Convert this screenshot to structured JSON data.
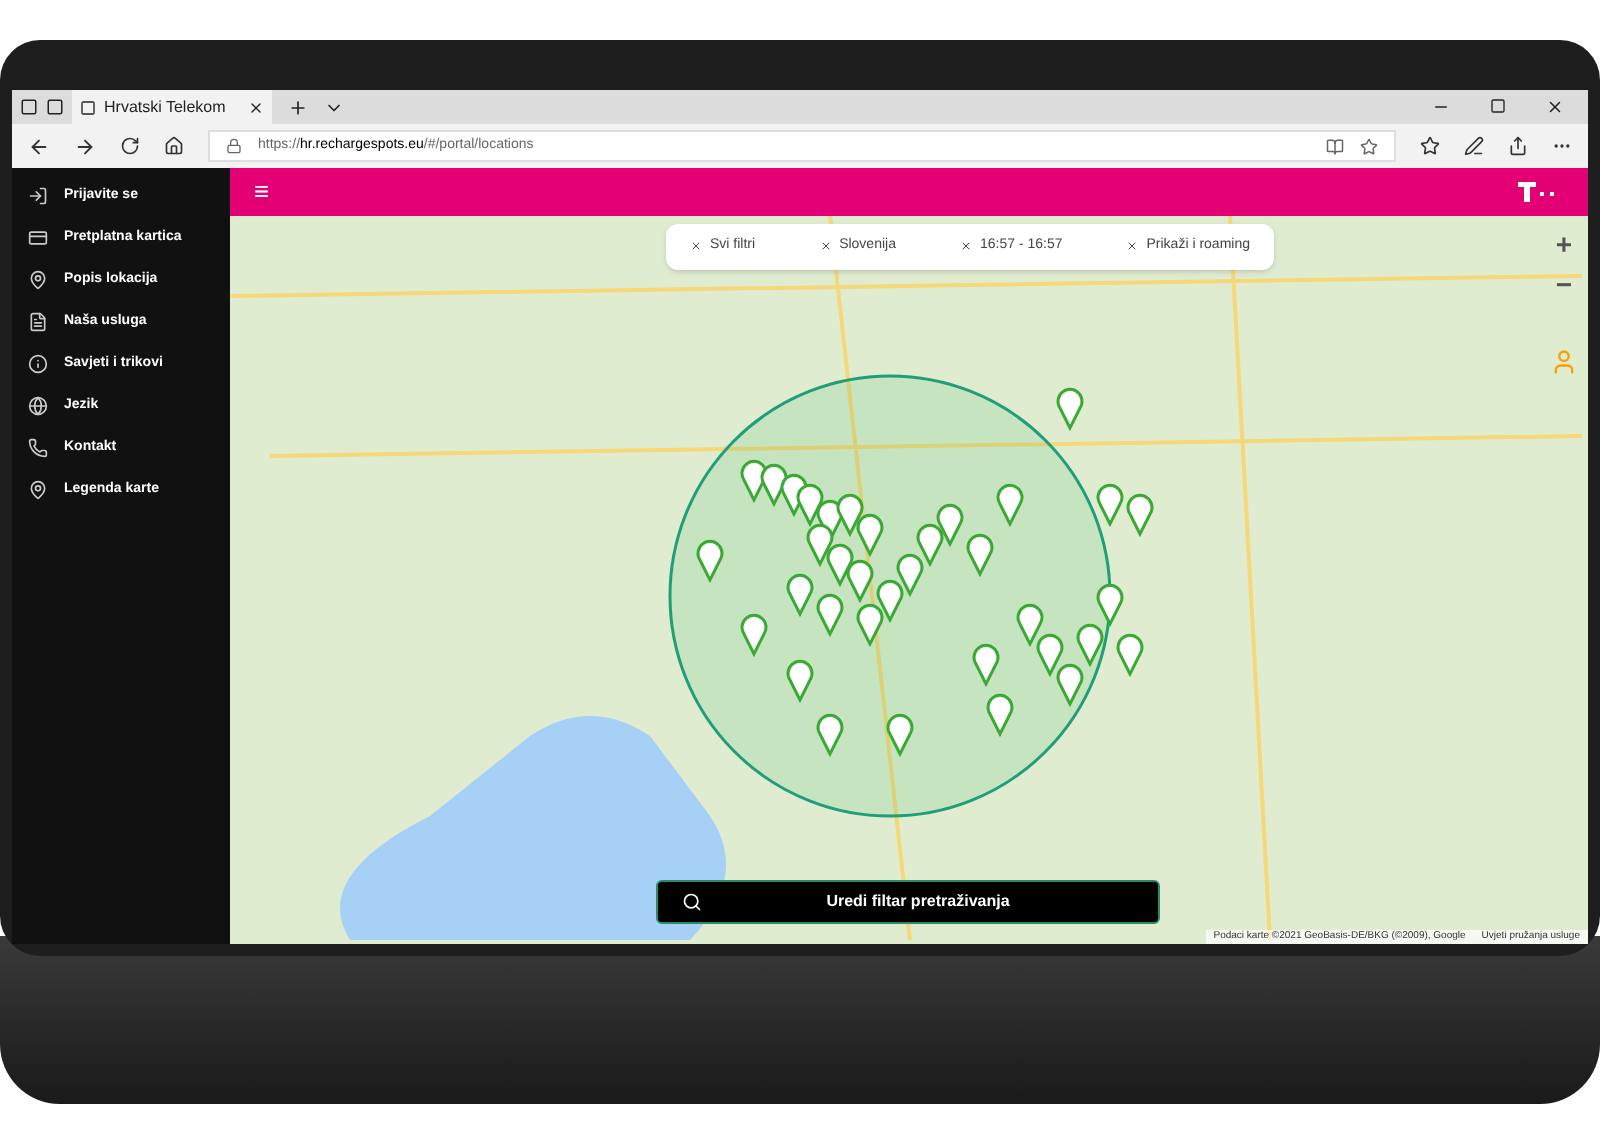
{
  "browser": {
    "tab_title": "Hrvatski Telekom",
    "url_prefix": "https://",
    "url_host": "hr.rechargespots.eu",
    "url_path": "/#/portal/locations"
  },
  "header": {
    "menu_icon": "≡"
  },
  "sidebar": {
    "items": [
      {
        "label": "Prijavite se"
      },
      {
        "label": "Pretplatna kartica"
      },
      {
        "label": "Popis lokacija"
      },
      {
        "label": "Naša usluga"
      },
      {
        "label": "Savjeti i trikovi"
      },
      {
        "label": "Jezik"
      },
      {
        "label": "Kontakt"
      },
      {
        "label": "Legenda karte"
      }
    ]
  },
  "filters": [
    {
      "label": "Svi filtri"
    },
    {
      "label": "Slovenija"
    },
    {
      "label": "16:57 - 16:57"
    },
    {
      "label": "Prikaži i roaming"
    }
  ],
  "map": {
    "zoom_in": "+",
    "zoom_out": "−",
    "attribution": "Podaci karte ©2021 GeoBasis-DE/BKG (©2009), Google",
    "terms": "Uvjeti pružanja usluge"
  },
  "search_button": {
    "label": "Uredi filtar pretraživanja"
  }
}
